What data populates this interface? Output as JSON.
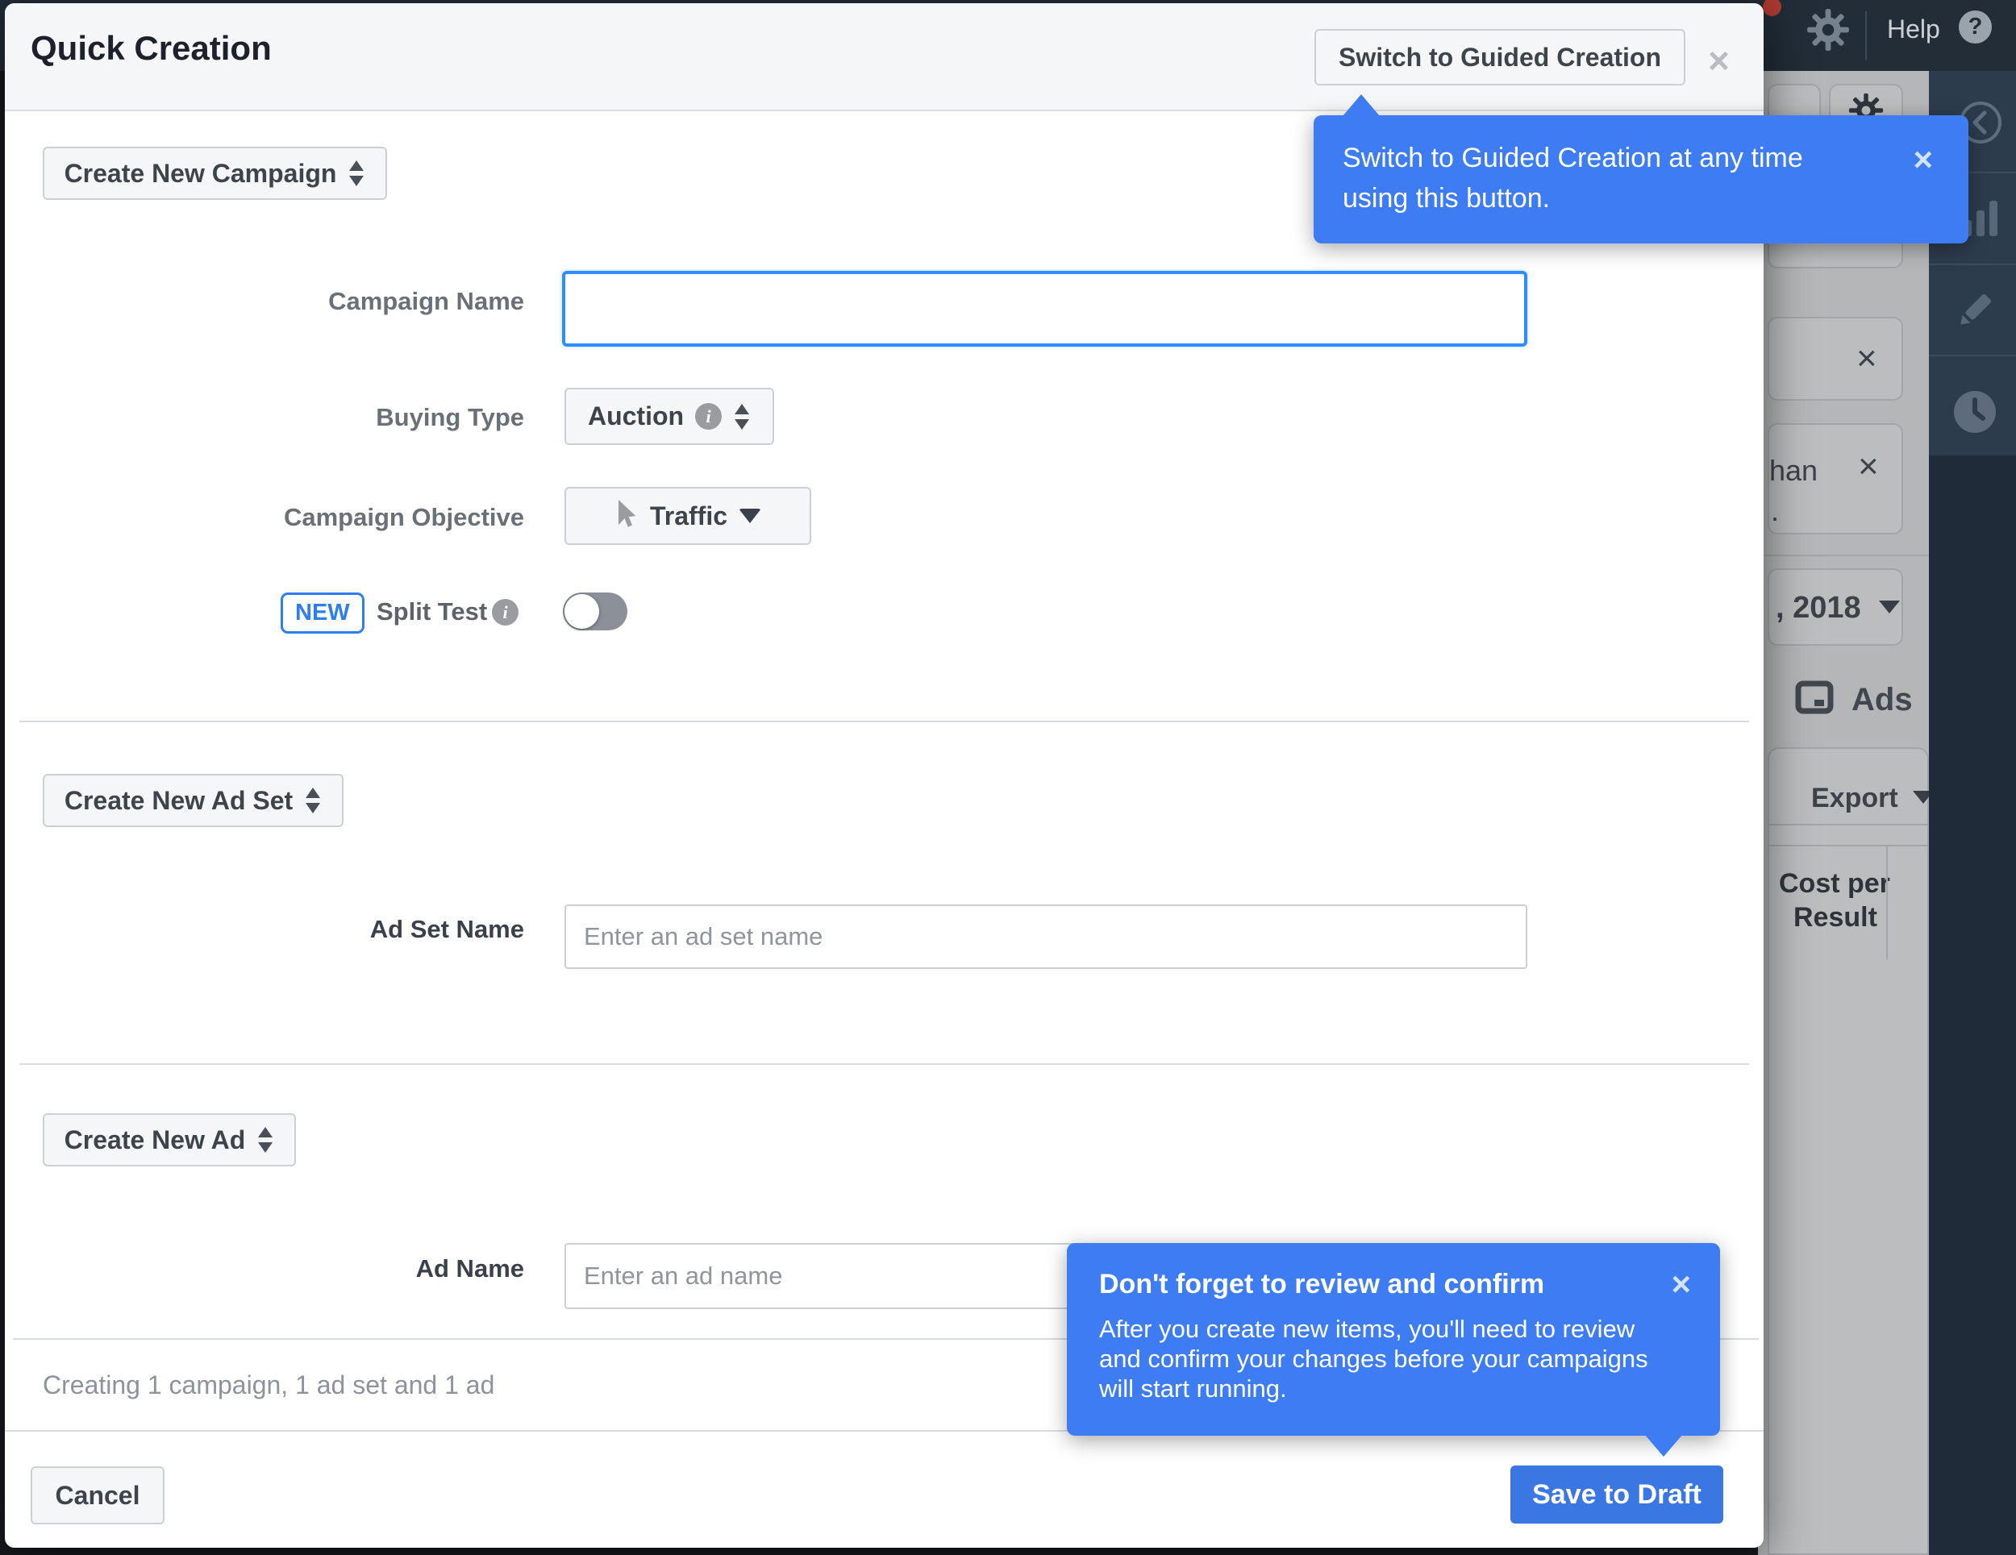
{
  "modal": {
    "title": "Quick Creation",
    "switch_button_label": "Switch to Guided Creation",
    "campaign": {
      "selector_label": "Create New Campaign",
      "name_label": "Campaign Name",
      "name_value": "",
      "buying_type_label": "Buying Type",
      "buying_type_value": "Auction",
      "objective_label": "Campaign Objective",
      "objective_value": "Traffic",
      "new_badge": "NEW",
      "split_test_label": "Split Test",
      "split_test_state": "off"
    },
    "ad_set": {
      "selector_label": "Create New Ad Set",
      "name_label": "Ad Set Name",
      "name_placeholder": "Enter an ad set name"
    },
    "ad": {
      "selector_label": "Create New Ad",
      "name_label": "Ad Name",
      "name_placeholder": "Enter an ad name"
    },
    "summary_text": "Creating 1 campaign, 1 ad set and 1 ad",
    "cancel_label": "Cancel",
    "save_label": "Save to Draft"
  },
  "tooltips": {
    "guided": {
      "lines": {
        "0": "Switch to Guided Creation at any time",
        "1": "using this button."
      }
    },
    "review": {
      "title": "Don't forget to review and confirm",
      "body_lines": {
        "0": "After you create new items, you'll need to review",
        "1": "and confirm your changes before your campaigns",
        "2": "will start running."
      }
    }
  },
  "background": {
    "help_label": "Help",
    "audience_fragment": "han",
    "dot_fragment": ".",
    "date_fragment": ", 2018",
    "ads_tab_label": "Ads",
    "export_label": "Export",
    "cost_header_line1": "Cost per",
    "cost_header_line2": "Result"
  },
  "icons": {
    "close": "×",
    "question": "?",
    "info": "i"
  },
  "colors": {
    "tooltip_blue": "#3d7cf2",
    "primary_button_blue": "#3a77e3",
    "focus_border_blue": "#2d8cff",
    "new_badge_blue": "#2d7eef",
    "header_dark": "#222d38",
    "sidebar_dark": "#2d3c4d",
    "notification_red": "#b03a31"
  }
}
